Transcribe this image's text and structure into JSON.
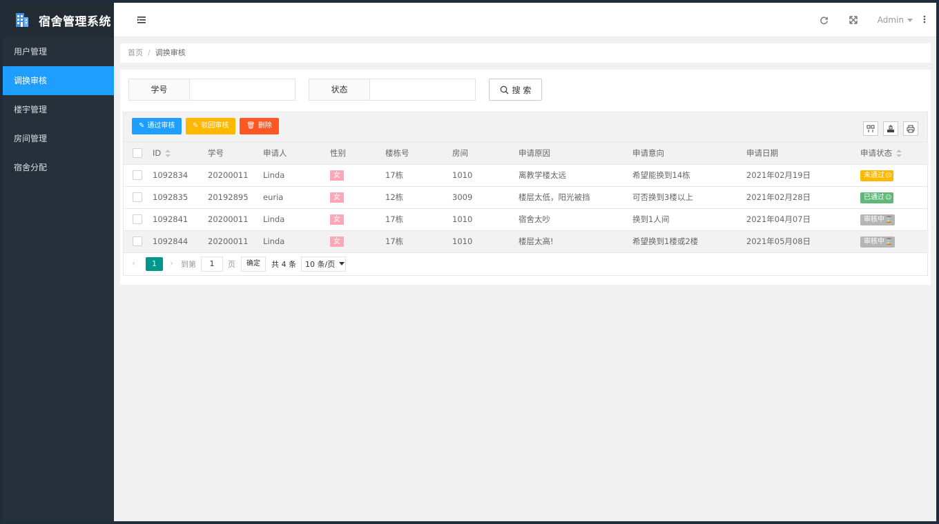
{
  "app": {
    "title": "宿舍管理系统"
  },
  "sidebar": {
    "items": [
      {
        "label": "用户管理"
      },
      {
        "label": "调换审核"
      },
      {
        "label": "楼宇管理"
      },
      {
        "label": "房间管理"
      },
      {
        "label": "宿舍分配"
      }
    ],
    "active": "调换审核"
  },
  "header": {
    "user": "Admin"
  },
  "breadcrumb": {
    "home": "首页",
    "sep": "/",
    "current": "调换审核"
  },
  "search": {
    "field1_label": "学号",
    "field1_value": "",
    "field2_label": "状态",
    "field2_value": "",
    "button_label": "搜 索"
  },
  "toolbar": {
    "approve_label": "通过审核",
    "reject_label": "驳回审核",
    "delete_label": "删除"
  },
  "table": {
    "columns": [
      "ID",
      "学号",
      "申请人",
      "性别",
      "楼栋号",
      "房间",
      "申请原因",
      "申请意向",
      "申请日期",
      "申请状态"
    ],
    "rows": [
      [
        "1092834",
        "20200011",
        "Linda",
        "女",
        "17栋",
        "1010",
        "离教学楼太远",
        "希望能换到14栋",
        "2021年02月19日",
        "未通过"
      ],
      [
        "1092835",
        "20192895",
        "euria",
        "女",
        "12栋",
        "3009",
        "楼层太低，阳光被挡",
        "可否换到3楼以上",
        "2021年02月28日",
        "已通过"
      ],
      [
        "1092841",
        "20200011",
        "Linda",
        "女",
        "17栋",
        "1010",
        "宿舍太吵",
        "换到1人间",
        "2021年04月07日",
        "审核中"
      ],
      [
        "1092844",
        "20200011",
        "Linda",
        "女",
        "17栋",
        "1010",
        "楼层太高!",
        "希望换到1楼或2楼",
        "2021年05月08日",
        "审核中"
      ]
    ]
  },
  "pager": {
    "current": "1",
    "goto_label": "到第",
    "page_input": "1",
    "page_unit": "页",
    "confirm_label": "确定",
    "total": "共 4 条",
    "page_size": "10 条/页"
  },
  "colors": {
    "accent": "#1e9fff",
    "approve": "#1e9fff",
    "reject": "#ffb800",
    "delete": "#ff5722",
    "pager_active": "#009688"
  }
}
